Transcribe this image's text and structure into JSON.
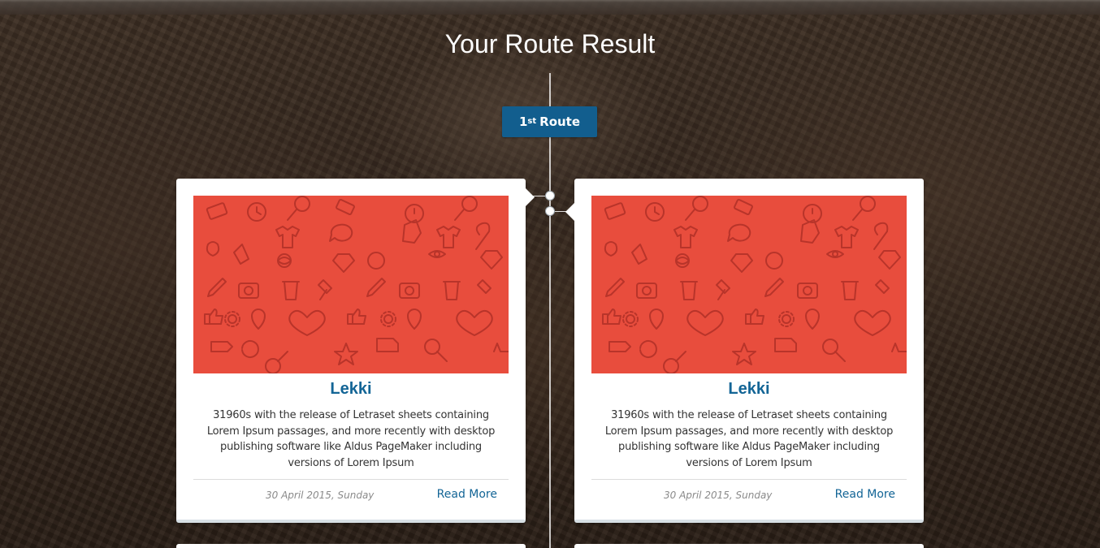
{
  "page": {
    "title": "Your Route Result"
  },
  "route_badge": {
    "ordinal": "1",
    "suffix": "st",
    "label": "Route",
    "color": "#125e8e"
  },
  "colors": {
    "accent_blue": "#136596",
    "image_red": "#e84d3d"
  },
  "cards": [
    {
      "title": "Lekki",
      "description": "31960s with the release of Letraset sheets containing Lorem Ipsum passages, and more recently with desktop publishing software like Aldus PageMaker including versions of Lorem Ipsum",
      "date": "30 April 2015, Sunday",
      "link": "Read More",
      "image_icon": "pattern-icons"
    },
    {
      "title": "Lekki",
      "description": "31960s with the release of Letraset sheets containing Lorem Ipsum passages, and more recently with desktop publishing software like Aldus PageMaker including versions of Lorem Ipsum",
      "date": "30 April 2015, Sunday",
      "link": "Read More",
      "image_icon": "pattern-icons"
    }
  ]
}
